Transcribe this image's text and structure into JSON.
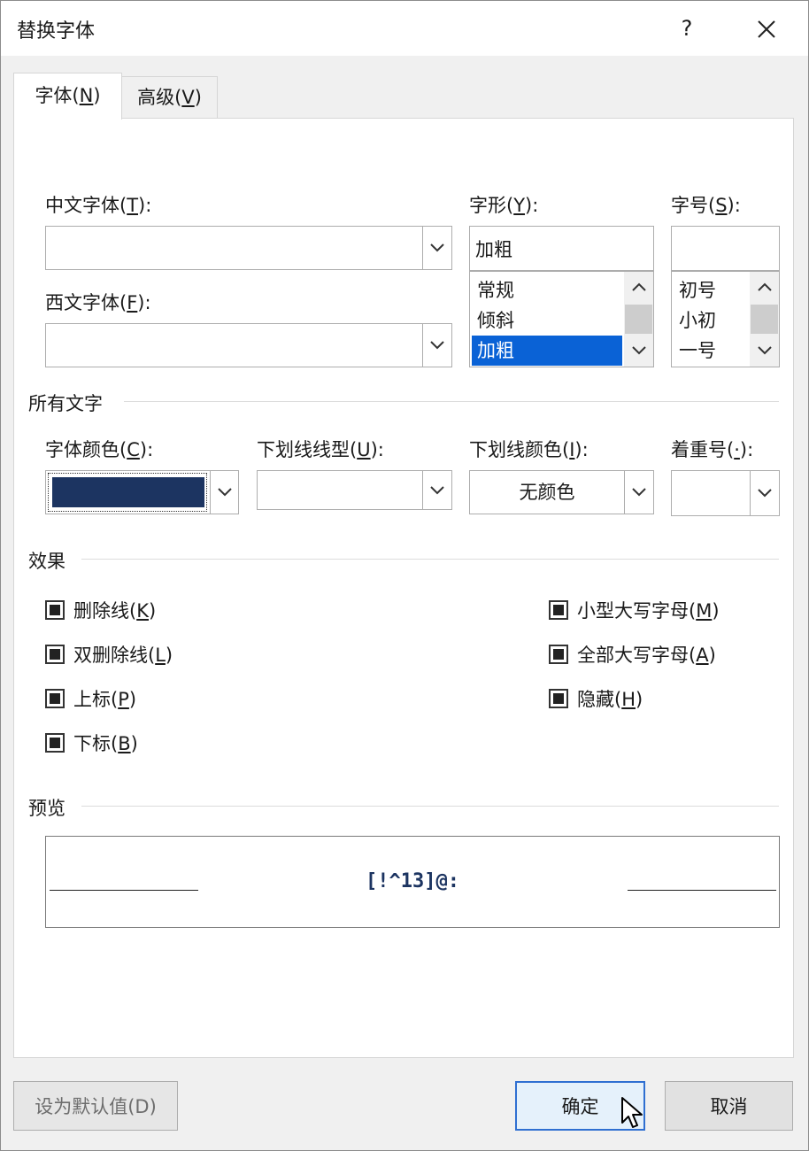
{
  "dialog": {
    "title": "替换字体",
    "help_label": "?",
    "close_label": "×"
  },
  "tabs": [
    {
      "label_pre": "字体(",
      "mnemonic": "N",
      "label_post": ")",
      "active": true
    },
    {
      "label_pre": "高级(",
      "mnemonic": "V",
      "label_post": ")",
      "active": false
    }
  ],
  "font_section": {
    "chinese_font": {
      "label_pre": "中文字体(",
      "mnemonic": "T",
      "label_post": "):",
      "value": ""
    },
    "western_font": {
      "label_pre": "西文字体(",
      "mnemonic": "F",
      "label_post": "):",
      "value": ""
    },
    "style": {
      "label_pre": "字形(",
      "mnemonic": "Y",
      "label_post": "):",
      "value": "加粗",
      "options": [
        "常规",
        "倾斜",
        "加粗"
      ],
      "selected": "加粗"
    },
    "size": {
      "label_pre": "字号(",
      "mnemonic": "S",
      "label_post": "):",
      "value": "",
      "options": [
        "初号",
        "小初",
        "一号"
      ]
    }
  },
  "all_text": {
    "title": "所有文字",
    "font_color": {
      "label_pre": "字体颜色(",
      "mnemonic": "C",
      "label_post": "):",
      "swatch_color": "#1c3461"
    },
    "underline_style": {
      "label_pre": "下划线线型(",
      "mnemonic": "U",
      "label_post": "):",
      "value": ""
    },
    "underline_color": {
      "label_pre": "下划线颜色(",
      "mnemonic": "I",
      "label_post": "):",
      "value": "无颜色"
    },
    "emphasis": {
      "label_pre": "着重号(",
      "mnemonic": "·",
      "label_post": "):",
      "value": ""
    }
  },
  "effects": {
    "title": "效果",
    "left": [
      {
        "label_pre": "删除线(",
        "mnemonic": "K",
        "label_post": ")"
      },
      {
        "label_pre": "双删除线(",
        "mnemonic": "L",
        "label_post": ")"
      },
      {
        "label_pre": "上标(",
        "mnemonic": "P",
        "label_post": ")"
      },
      {
        "label_pre": "下标(",
        "mnemonic": "B",
        "label_post": ")"
      }
    ],
    "right": [
      {
        "label_pre": "小型大写字母(",
        "mnemonic": "M",
        "label_post": ")"
      },
      {
        "label_pre": "全部大写字母(",
        "mnemonic": "A",
        "label_post": ")"
      },
      {
        "label_pre": "隐藏(",
        "mnemonic": "H",
        "label_post": ")"
      }
    ]
  },
  "preview": {
    "title": "预览",
    "sample": "[!^13]@:"
  },
  "buttons": {
    "set_default": "设为默认值(D)",
    "ok": "确定",
    "cancel": "取消"
  },
  "colors": {
    "accent": "#0a62d6",
    "ok_border": "#2f6fd1",
    "preview_text": "#1c3461"
  }
}
